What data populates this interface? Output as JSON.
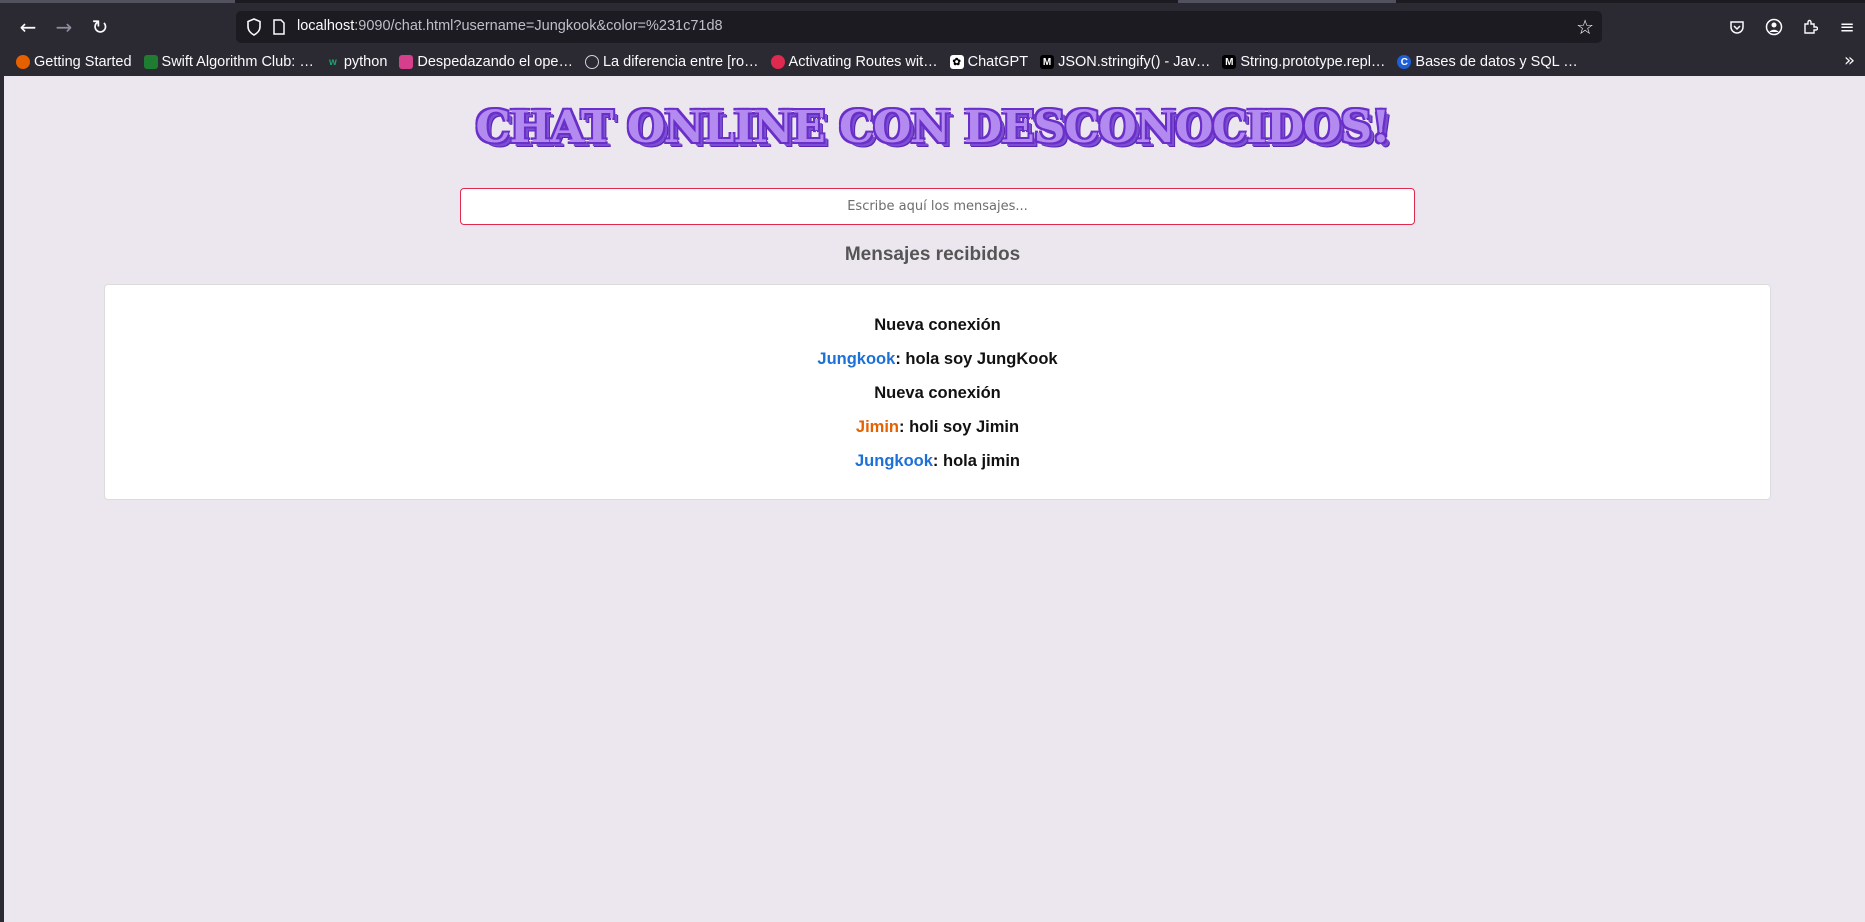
{
  "browser": {
    "url_host": "localhost",
    "url_rest": ":9090/chat.html?username=Jungkook&color=%231c71d8",
    "bookmarks": [
      {
        "label": "Getting Started",
        "icon": "firefox-icon",
        "color": "#e66000"
      },
      {
        "label": "Swift Algorithm Club: …",
        "icon": "github-icon",
        "color": "#1e7d32"
      },
      {
        "label": "python",
        "icon": "w-icon",
        "color": "#1ba672"
      },
      {
        "label": "Despedazando el ope…",
        "icon": "blog-icon",
        "color": "#d53f8c"
      },
      {
        "label": "La diferencia entre [ro…",
        "icon": "globe-icon",
        "color": "#cfcfd8"
      },
      {
        "label": "Activating Routes wit…",
        "icon": "route-icon",
        "color": "#e0294f"
      },
      {
        "label": "ChatGPT",
        "icon": "chatgpt-icon",
        "color": "#ffffff"
      },
      {
        "label": "JSON.stringify() - Jav…",
        "icon": "mdn-icon",
        "color": "#000000"
      },
      {
        "label": "String.prototype.repl…",
        "icon": "mdn-icon",
        "color": "#000000"
      },
      {
        "label": "Bases de datos y SQL …",
        "icon": "c-icon",
        "color": "#1c5fd8"
      }
    ]
  },
  "page": {
    "title": "CHAT ONLINE CON DESCONOCIDOS!",
    "input_placeholder": "Escribe aquí los mensajes...",
    "subtitle": "Mensajes recibidos"
  },
  "messages": [
    {
      "type": "system",
      "text": "Nueva conexión"
    },
    {
      "type": "chat",
      "user": "Jungkook",
      "user_color": "#1c71d8",
      "text": ": hola soy JungKook"
    },
    {
      "type": "system",
      "text": "Nueva conexión"
    },
    {
      "type": "chat",
      "user": "Jimin",
      "user_color": "#e66100",
      "text": ": holi soy Jimin"
    },
    {
      "type": "chat",
      "user": "Jungkook",
      "user_color": "#1c71d8",
      "text": ": hola jimin"
    }
  ]
}
